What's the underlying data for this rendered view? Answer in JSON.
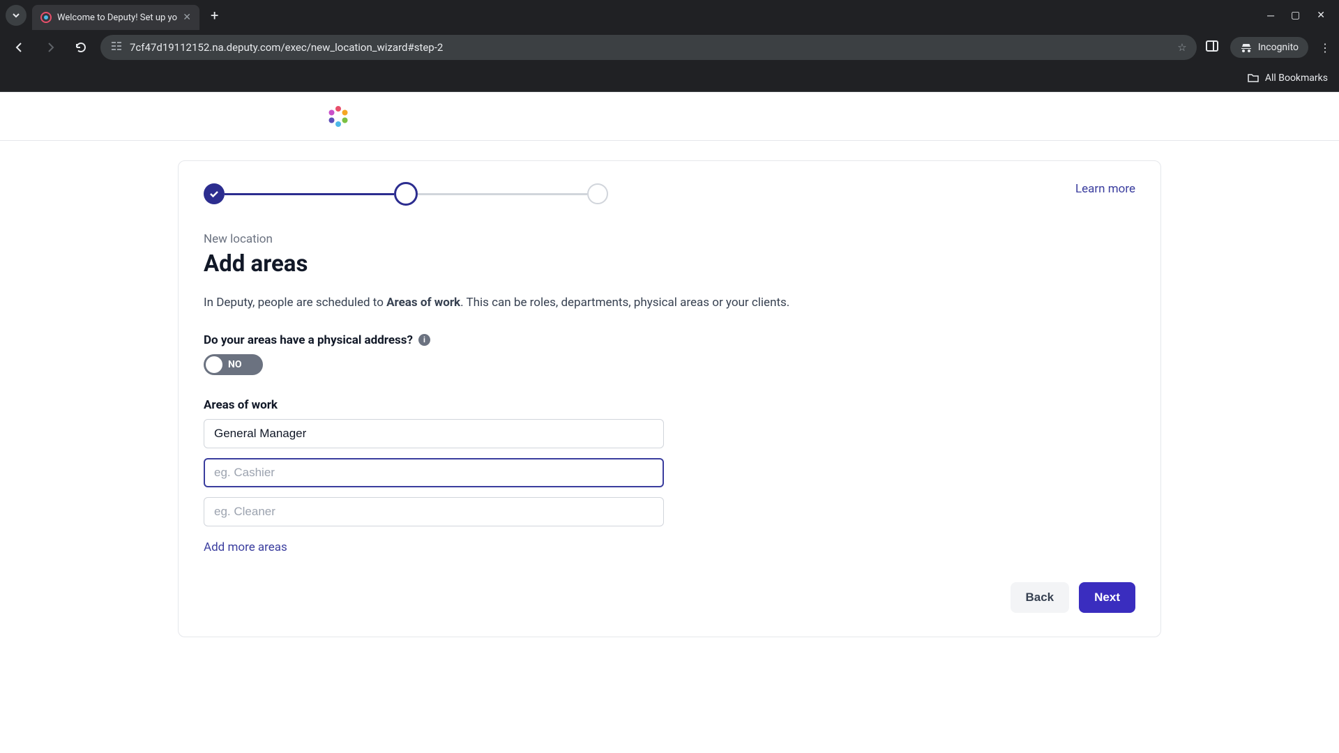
{
  "browser": {
    "tab_title": "Welcome to Deputy! Set up yo",
    "url": "7cf47d19112152.na.deputy.com/exec/new_location_wizard#step-2",
    "incognito_label": "Incognito",
    "all_bookmarks": "All Bookmarks"
  },
  "learn_more": "Learn more",
  "breadcrumb": "New location",
  "title": "Add areas",
  "description_pre": "In Deputy, people are scheduled to ",
  "description_bold": "Areas of work",
  "description_post": ". This can be roles, departments, physical areas or your clients.",
  "question": "Do your areas have a physical address?",
  "toggle_state": "NO",
  "areas_label": "Areas of work",
  "area_inputs": [
    {
      "value": "General Manager",
      "placeholder": ""
    },
    {
      "value": "",
      "placeholder": "eg. Cashier"
    },
    {
      "value": "",
      "placeholder": "eg. Cleaner"
    }
  ],
  "add_more": "Add more areas",
  "back_label": "Back",
  "next_label": "Next"
}
